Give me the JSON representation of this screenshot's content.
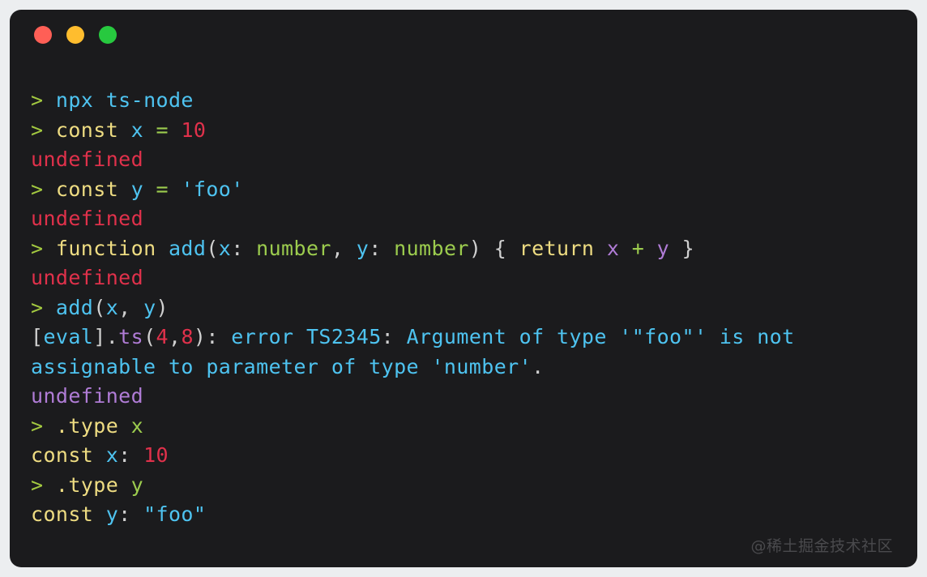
{
  "window": {
    "background": "#1b1b1d",
    "page_background": "#eceef0",
    "controls": [
      {
        "name": "close",
        "color": "#ff5f56"
      },
      {
        "name": "minimize",
        "color": "#ffbd2e"
      },
      {
        "name": "maximize",
        "color": "#27c93f"
      }
    ]
  },
  "watermark": "@稀土掘金技术社区",
  "terminal": {
    "lines": [
      {
        "id": "line-1",
        "kind": "input",
        "text": "> npx ts-node",
        "tokens": [
          {
            "t": "> ",
            "c": "tok-prompt"
          },
          {
            "t": "npx ts-node",
            "c": "tok-cmd"
          }
        ]
      },
      {
        "id": "line-2",
        "kind": "input",
        "text": "> const x = 10",
        "tokens": [
          {
            "t": "> ",
            "c": "tok-prompt"
          },
          {
            "t": "const",
            "c": "tok-keyword"
          },
          {
            "t": " ",
            "c": "tok-punct"
          },
          {
            "t": "x",
            "c": "tok-var"
          },
          {
            "t": " ",
            "c": "tok-punct"
          },
          {
            "t": "=",
            "c": "tok-op"
          },
          {
            "t": " ",
            "c": "tok-punct"
          },
          {
            "t": "10",
            "c": "tok-num"
          }
        ]
      },
      {
        "id": "line-3",
        "kind": "output",
        "text": "undefined",
        "tokens": [
          {
            "t": "undefined",
            "c": "tok-undef-red"
          }
        ]
      },
      {
        "id": "line-4",
        "kind": "input",
        "text": "> const y = 'foo'",
        "tokens": [
          {
            "t": "> ",
            "c": "tok-prompt"
          },
          {
            "t": "const",
            "c": "tok-keyword"
          },
          {
            "t": " ",
            "c": "tok-punct"
          },
          {
            "t": "y",
            "c": "tok-var"
          },
          {
            "t": " ",
            "c": "tok-punct"
          },
          {
            "t": "=",
            "c": "tok-op"
          },
          {
            "t": " ",
            "c": "tok-punct"
          },
          {
            "t": "'foo'",
            "c": "tok-str"
          }
        ]
      },
      {
        "id": "line-5",
        "kind": "output",
        "text": "undefined",
        "tokens": [
          {
            "t": "undefined",
            "c": "tok-undef-red"
          }
        ]
      },
      {
        "id": "line-6",
        "kind": "input",
        "text": "> function add(x: number, y: number) { return x + y }",
        "tokens": [
          {
            "t": "> ",
            "c": "tok-prompt"
          },
          {
            "t": "function",
            "c": "tok-keyword"
          },
          {
            "t": " ",
            "c": "tok-punct"
          },
          {
            "t": "add",
            "c": "tok-fn"
          },
          {
            "t": "(",
            "c": "tok-punct"
          },
          {
            "t": "x",
            "c": "tok-var"
          },
          {
            "t": ": ",
            "c": "tok-punct"
          },
          {
            "t": "number",
            "c": "tok-type"
          },
          {
            "t": ", ",
            "c": "tok-punct"
          },
          {
            "t": "y",
            "c": "tok-var"
          },
          {
            "t": ": ",
            "c": "tok-punct"
          },
          {
            "t": "number",
            "c": "tok-type"
          },
          {
            "t": ")",
            "c": "tok-punct"
          },
          {
            "t": " ",
            "c": "tok-punct"
          },
          {
            "t": "{",
            "c": "tok-punct"
          },
          {
            "t": " ",
            "c": "tok-punct"
          },
          {
            "t": "return",
            "c": "tok-keyword"
          },
          {
            "t": " ",
            "c": "tok-punct"
          },
          {
            "t": "x",
            "c": "tok-param"
          },
          {
            "t": " ",
            "c": "tok-punct"
          },
          {
            "t": "+",
            "c": "tok-plus"
          },
          {
            "t": " ",
            "c": "tok-punct"
          },
          {
            "t": "y",
            "c": "tok-param"
          },
          {
            "t": " ",
            "c": "tok-punct"
          },
          {
            "t": "}",
            "c": "tok-punct"
          }
        ]
      },
      {
        "id": "line-7",
        "kind": "output",
        "text": "undefined",
        "tokens": [
          {
            "t": "undefined",
            "c": "tok-undef-red"
          }
        ]
      },
      {
        "id": "line-8",
        "kind": "input",
        "text": "> add(x, y)",
        "tokens": [
          {
            "t": "> ",
            "c": "tok-prompt"
          },
          {
            "t": "add",
            "c": "tok-fn"
          },
          {
            "t": "(",
            "c": "tok-punct"
          },
          {
            "t": "x",
            "c": "tok-var"
          },
          {
            "t": ", ",
            "c": "tok-punct"
          },
          {
            "t": "y",
            "c": "tok-var"
          },
          {
            "t": ")",
            "c": "tok-punct"
          }
        ]
      },
      {
        "id": "line-9",
        "kind": "error",
        "text": "[eval].ts(4,8): error TS2345: Argument of type '\"foo\"' is not",
        "tokens": [
          {
            "t": "[",
            "c": "tok-file"
          },
          {
            "t": "eval",
            "c": "tok-err"
          },
          {
            "t": "]",
            "c": "tok-file"
          },
          {
            "t": ".",
            "c": "tok-file"
          },
          {
            "t": "ts",
            "c": "tok-ext"
          },
          {
            "t": "(",
            "c": "tok-file"
          },
          {
            "t": "4",
            "c": "tok-num"
          },
          {
            "t": ",",
            "c": "tok-file"
          },
          {
            "t": "8",
            "c": "tok-num"
          },
          {
            "t": ")",
            "c": "tok-file"
          },
          {
            "t": ": ",
            "c": "tok-file"
          },
          {
            "t": "error TS2345",
            "c": "tok-err"
          },
          {
            "t": ":",
            "c": "tok-file"
          },
          {
            "t": " Argument of type '\"foo\"' is not",
            "c": "tok-err"
          }
        ]
      },
      {
        "id": "line-10",
        "kind": "error",
        "text": "assignable to parameter of type 'number'.",
        "tokens": [
          {
            "t": "assignable to parameter of type 'number'",
            "c": "tok-err"
          },
          {
            "t": ".",
            "c": "tok-file"
          }
        ]
      },
      {
        "id": "line-11",
        "kind": "output",
        "text": "undefined",
        "tokens": [
          {
            "t": "undefined",
            "c": "tok-undef-purple"
          }
        ]
      },
      {
        "id": "line-12",
        "kind": "input",
        "text": "> .type x",
        "tokens": [
          {
            "t": "> ",
            "c": "tok-prompt"
          },
          {
            "t": ".type",
            "c": "tok-dotcmd"
          },
          {
            "t": " ",
            "c": "tok-punct"
          },
          {
            "t": "x",
            "c": "tok-ident-g"
          }
        ]
      },
      {
        "id": "line-13",
        "kind": "output",
        "text": "const x: 10",
        "tokens": [
          {
            "t": "const",
            "c": "tok-keyword"
          },
          {
            "t": " ",
            "c": "tok-punct"
          },
          {
            "t": "x",
            "c": "tok-var"
          },
          {
            "t": ": ",
            "c": "tok-punct"
          },
          {
            "t": "10",
            "c": "tok-num"
          }
        ]
      },
      {
        "id": "line-14",
        "kind": "input",
        "text": "> .type y",
        "tokens": [
          {
            "t": "> ",
            "c": "tok-prompt"
          },
          {
            "t": ".type",
            "c": "tok-dotcmd"
          },
          {
            "t": " ",
            "c": "tok-punct"
          },
          {
            "t": "y",
            "c": "tok-ident-g"
          }
        ]
      },
      {
        "id": "line-15",
        "kind": "output",
        "text": "const y: \"foo\"",
        "tokens": [
          {
            "t": "const",
            "c": "tok-keyword"
          },
          {
            "t": " ",
            "c": "tok-punct"
          },
          {
            "t": "y",
            "c": "tok-var"
          },
          {
            "t": ": ",
            "c": "tok-punct"
          },
          {
            "t": "\"foo\"",
            "c": "tok-str"
          }
        ]
      }
    ]
  }
}
